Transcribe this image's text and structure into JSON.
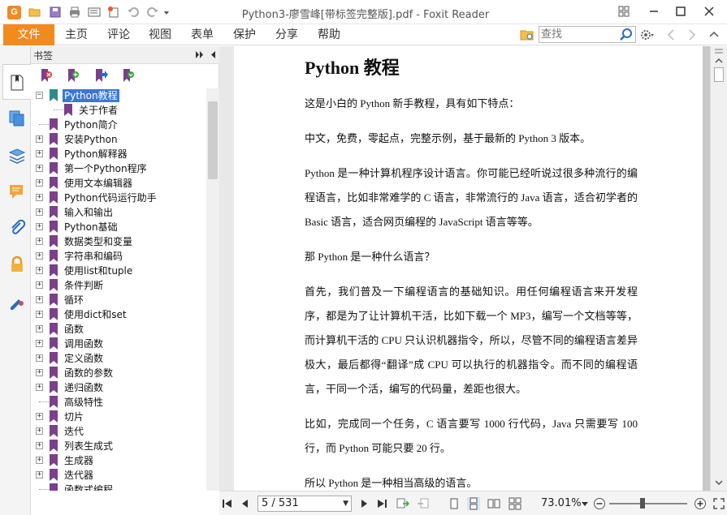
{
  "window": {
    "title": "Python3-廖雪峰[带标签完整版].pdf - Foxit Reader",
    "app_icon_letter": "G"
  },
  "menu": {
    "file": "文件",
    "items": [
      "主页",
      "评论",
      "视图",
      "表单",
      "保护",
      "分享",
      "帮助"
    ]
  },
  "search": {
    "placeholder": "查找"
  },
  "bookmarks": {
    "title": "书签",
    "items": [
      {
        "label": "Python教程",
        "toggle": "−",
        "selected": true,
        "level": 0
      },
      {
        "label": "关于作者",
        "toggle": "",
        "selected": false,
        "level": 1
      },
      {
        "label": "Python简介",
        "toggle": "",
        "selected": false,
        "level": 0
      },
      {
        "label": "安装Python",
        "toggle": "+",
        "selected": false,
        "level": 0
      },
      {
        "label": "Python解释器",
        "toggle": "+",
        "selected": false,
        "level": 0
      },
      {
        "label": "第一个Python程序",
        "toggle": "+",
        "selected": false,
        "level": 0
      },
      {
        "label": "使用文本编辑器",
        "toggle": "+",
        "selected": false,
        "level": 0
      },
      {
        "label": "Python代码运行助手",
        "toggle": "+",
        "selected": false,
        "level": 0
      },
      {
        "label": "输入和输出",
        "toggle": "+",
        "selected": false,
        "level": 0
      },
      {
        "label": "Python基础",
        "toggle": "+",
        "selected": false,
        "level": 0
      },
      {
        "label": "数据类型和变量",
        "toggle": "+",
        "selected": false,
        "level": 0
      },
      {
        "label": "字符串和编码",
        "toggle": "+",
        "selected": false,
        "level": 0
      },
      {
        "label": "使用list和tuple",
        "toggle": "+",
        "selected": false,
        "level": 0
      },
      {
        "label": "条件判断",
        "toggle": "+",
        "selected": false,
        "level": 0
      },
      {
        "label": "循环",
        "toggle": "+",
        "selected": false,
        "level": 0
      },
      {
        "label": "使用dict和set",
        "toggle": "+",
        "selected": false,
        "level": 0
      },
      {
        "label": "函数",
        "toggle": "+",
        "selected": false,
        "level": 0
      },
      {
        "label": "调用函数",
        "toggle": "+",
        "selected": false,
        "level": 0
      },
      {
        "label": "定义函数",
        "toggle": "+",
        "selected": false,
        "level": 0
      },
      {
        "label": "函数的参数",
        "toggle": "+",
        "selected": false,
        "level": 0
      },
      {
        "label": "递归函数",
        "toggle": "+",
        "selected": false,
        "level": 0
      },
      {
        "label": "高级特性",
        "toggle": "",
        "selected": false,
        "level": 0
      },
      {
        "label": "切片",
        "toggle": "+",
        "selected": false,
        "level": 0
      },
      {
        "label": "迭代",
        "toggle": "+",
        "selected": false,
        "level": 0
      },
      {
        "label": "列表生成式",
        "toggle": "+",
        "selected": false,
        "level": 0
      },
      {
        "label": "生成器",
        "toggle": "+",
        "selected": false,
        "level": 0
      },
      {
        "label": "迭代器",
        "toggle": "+",
        "selected": false,
        "level": 0
      },
      {
        "label": "函数式编程",
        "toggle": "",
        "selected": false,
        "level": 0
      }
    ]
  },
  "document": {
    "title": "Python 教程",
    "paragraphs": [
      "这是小白的 Python 新手教程，具有如下特点：",
      "中文，免费，零起点，完整示例，基于最新的 Python 3 版本。",
      "Python 是一种计算机程序设计语言。你可能已经听说过很多种流行的编程语言，比如非常难学的 C 语言，非常流行的 Java 语言，适合初学者的 Basic 语言，适合网页编程的 JavaScript 语言等等。",
      "那 Python 是一种什么语言？",
      "首先，我们普及一下编程语言的基础知识。用任何编程语言来开发程序，都是为了让计算机干活，比如下载一个 MP3，编写一个文档等等，而计算机干活的 CPU 只认识机器指令，所以，尽管不同的编程语言差异极大，最后都得“翻译”成 CPU 可以执行的机器指令。而不同的编程语言，干同一个活，编写的代码量，差距也很大。",
      "比如，完成同一个任务，C 语言要写 1000 行代码，Java 只需要写 100 行，而 Python 可能只要 20 行。",
      "所以 Python 是一种相当高级的语言。"
    ]
  },
  "status": {
    "page": "5 / 531",
    "zoom": "73.01%"
  },
  "colors": {
    "accent": "#f28a1f",
    "bookmark": "#7b3f8c",
    "bookmark_selected": "#2e8b8b",
    "selection": "#3a78d6"
  }
}
